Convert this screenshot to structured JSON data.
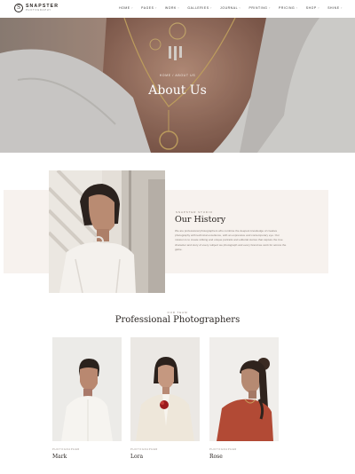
{
  "brand": {
    "mark": "S",
    "name": "SNAPSTER",
    "tagline": "PHOTOGRAPHY"
  },
  "nav": [
    "HOME",
    "PAGES",
    "WORK",
    "GALLERIES",
    "JOURNAL",
    "PRINTING",
    "PRICING",
    "SHOP",
    "SHINE"
  ],
  "hero": {
    "breadcrumb": "HOME / ABOUT US",
    "title": "About Us"
  },
  "history": {
    "kicker": "SNAPSTER STUDIO",
    "title": "Our History",
    "body": "We are professional photographers who combine the deepest knowledge of creative photography with technical excellence, with an expressive and contemporary eye. Our mission is to create striking and unique portraits and editorial stories that capture the true character and story of every subject we photograph and every brand we work for across the globe."
  },
  "team": {
    "kicker": "OUR TEAM",
    "title": "Professional Photographers",
    "members": [
      {
        "role": "PHOTOGRAPHER",
        "name": "Mark"
      },
      {
        "role": "PHOTOGRAPHER",
        "name": "Lora"
      },
      {
        "role": "PHOTOGRAPHER",
        "name": "Rose"
      }
    ]
  }
}
